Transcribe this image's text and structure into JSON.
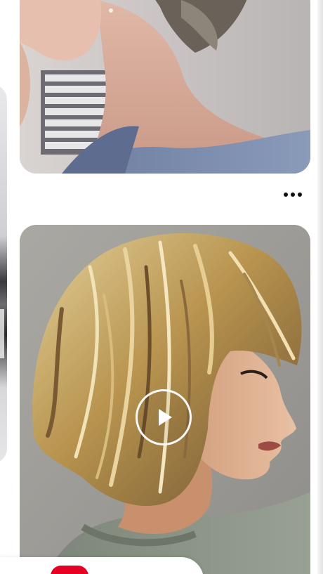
{
  "feed": {
    "pins": [
      {
        "type": "image",
        "subject": "short-haircut-back-view"
      },
      {
        "type": "video",
        "subject": "layered-blonde-shag-haircut-profile"
      }
    ]
  },
  "icons": {
    "more": "more-horizontal-icon",
    "play": "play-icon"
  },
  "colors": {
    "background": "#ffffff",
    "accent": "#e60023",
    "icon": "#111111"
  }
}
